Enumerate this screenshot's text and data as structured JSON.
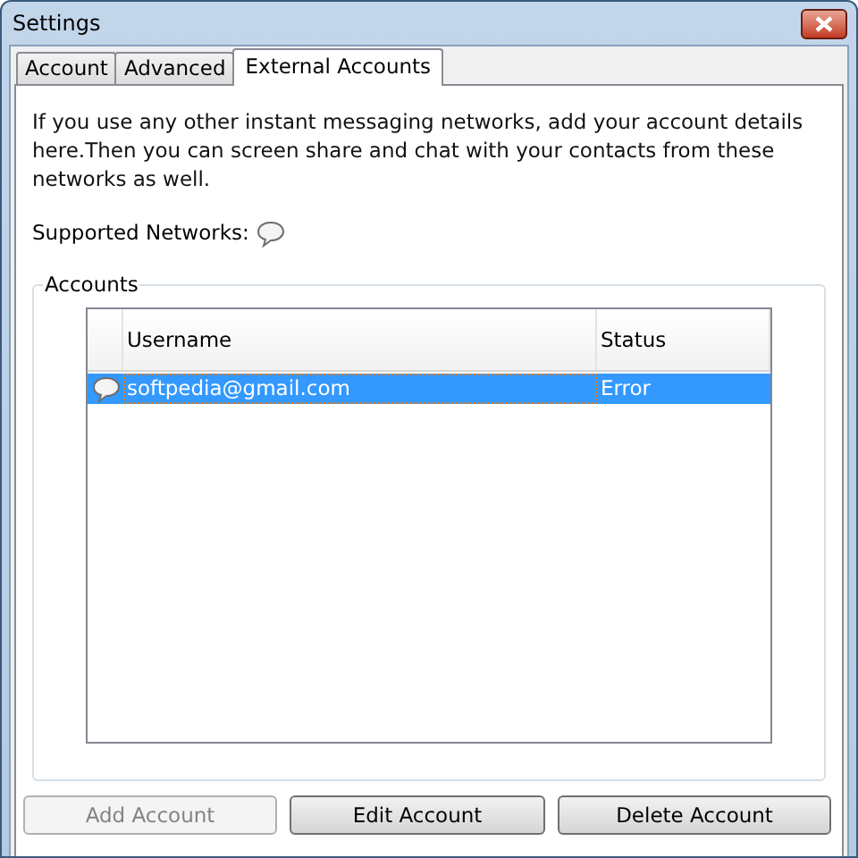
{
  "window": {
    "title": "Settings"
  },
  "tabs": [
    {
      "label": "Account",
      "selected": false
    },
    {
      "label": "Advanced",
      "selected": false
    },
    {
      "label": "External Accounts",
      "selected": true
    }
  ],
  "description": "If you use any other instant messaging networks, add your account details here.Then you can screen share and chat with your contacts from these networks as well.",
  "supported_networks_label": "Supported Networks:",
  "accounts": {
    "title": "Accounts",
    "columns": [
      "Username",
      "Status"
    ],
    "rows": [
      {
        "username": "softpedia@gmail.com",
        "status": "Error",
        "selected": true
      }
    ]
  },
  "buttons": [
    {
      "label": "Add Account",
      "disabled": true
    },
    {
      "label": "Edit Account",
      "disabled": false
    },
    {
      "label": "Delete Account",
      "disabled": false
    }
  ]
}
